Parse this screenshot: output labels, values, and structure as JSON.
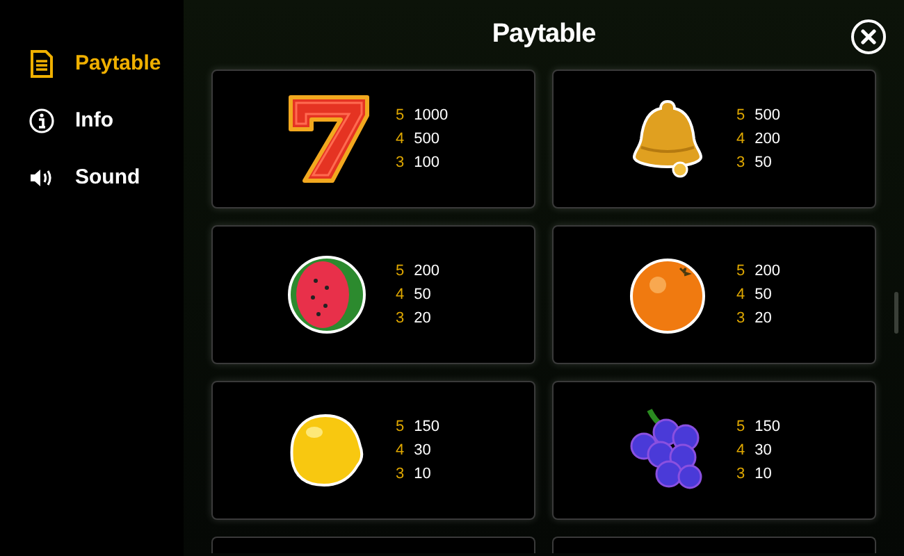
{
  "sidebar": {
    "items": [
      {
        "kind": "document",
        "label": "Paytable",
        "selected": true
      },
      {
        "kind": "info",
        "label": "Info",
        "selected": false
      },
      {
        "kind": "speaker",
        "label": "Sound",
        "selected": false
      }
    ]
  },
  "title": "Paytable",
  "symbols": [
    {
      "kind": "seven",
      "pays": [
        {
          "count": "5",
          "amount": "1000"
        },
        {
          "count": "4",
          "amount": "500"
        },
        {
          "count": "3",
          "amount": "100"
        }
      ]
    },
    {
      "kind": "bell",
      "pays": [
        {
          "count": "5",
          "amount": "500"
        },
        {
          "count": "4",
          "amount": "200"
        },
        {
          "count": "3",
          "amount": "50"
        }
      ]
    },
    {
      "kind": "watermelon",
      "pays": [
        {
          "count": "5",
          "amount": "200"
        },
        {
          "count": "4",
          "amount": "50"
        },
        {
          "count": "3",
          "amount": "20"
        }
      ]
    },
    {
      "kind": "orange",
      "pays": [
        {
          "count": "5",
          "amount": "200"
        },
        {
          "count": "4",
          "amount": "50"
        },
        {
          "count": "3",
          "amount": "20"
        }
      ]
    },
    {
      "kind": "lemon",
      "pays": [
        {
          "count": "5",
          "amount": "150"
        },
        {
          "count": "4",
          "amount": "30"
        },
        {
          "count": "3",
          "amount": "10"
        }
      ]
    },
    {
      "kind": "grapes",
      "pays": [
        {
          "count": "5",
          "amount": "150"
        },
        {
          "count": "4",
          "amount": "30"
        },
        {
          "count": "3",
          "amount": "10"
        }
      ]
    }
  ]
}
